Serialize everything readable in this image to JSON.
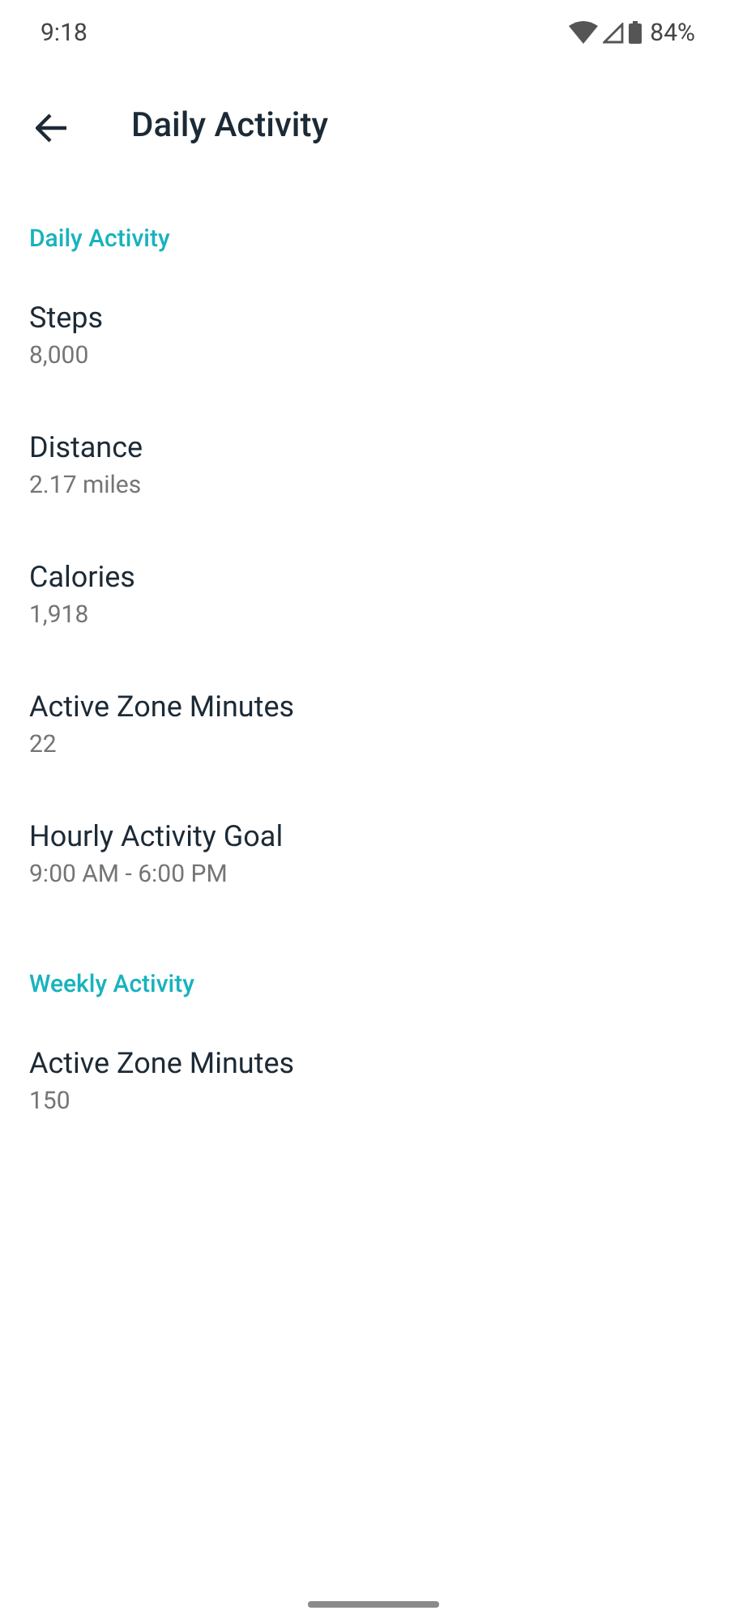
{
  "status_bar": {
    "time": "9:18",
    "battery": "84%"
  },
  "header": {
    "title": "Daily Activity"
  },
  "sections": [
    {
      "title": "Daily Activity",
      "items": [
        {
          "label": "Steps",
          "value": "8,000"
        },
        {
          "label": "Distance",
          "value": "2.17 miles"
        },
        {
          "label": "Calories",
          "value": "1,918"
        },
        {
          "label": "Active Zone Minutes",
          "value": "22"
        },
        {
          "label": "Hourly Activity Goal",
          "value": "9:00 AM - 6:00 PM"
        }
      ]
    },
    {
      "title": "Weekly Activity",
      "items": [
        {
          "label": "Active Zone Minutes",
          "value": "150"
        }
      ]
    }
  ]
}
